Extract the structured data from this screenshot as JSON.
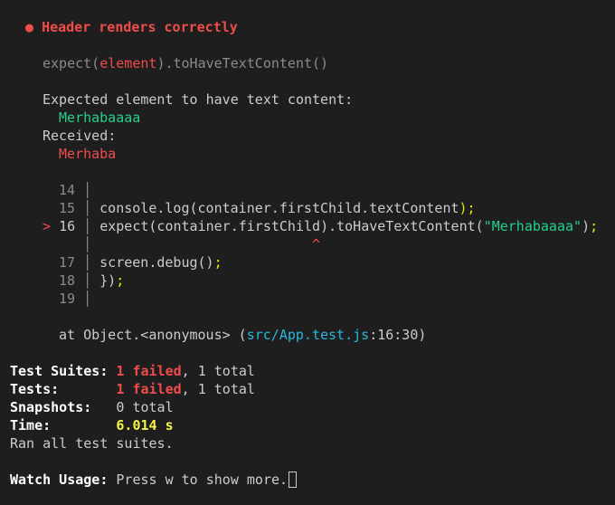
{
  "test": {
    "bullet": "●",
    "name": "Header renders correctly"
  },
  "matcher": {
    "prefix": "expect(",
    "received": "element",
    "suffix": ").toHaveTextContent()"
  },
  "message": {
    "expected_label": "Expected element to have text content:",
    "expected_value": "Merhabaaaa",
    "received_label": "Received:",
    "received_value": "Merhaba"
  },
  "code": {
    "lines": [
      {
        "num": "14",
        "text": ""
      },
      {
        "num": "15",
        "text": "console.log(container.firstChild.textContent);"
      },
      {
        "num": "16",
        "text": "expect(container.firstChild).toHaveTextContent(\"Merhabaaaa\");"
      },
      {
        "num": "17",
        "text": "screen.debug();"
      },
      {
        "num": "18",
        "text": "});"
      },
      {
        "num": "19",
        "text": ""
      }
    ],
    "marker": ">",
    "caret": "^",
    "seg": {
      "l15_a": "console",
      "l15_b": ".log(container.",
      "l15_c": "firstChild",
      "l15_d": ".",
      "l15_e": "textContent",
      "l15_f": ");",
      "l16_a": "expect(container.",
      "l16_b": "firstChild",
      "l16_c": ")",
      "l16_d": ".",
      "l16_e": "toHaveTextContent(",
      "l16_f": "\"Merhabaaaa\"",
      "l16_g": ")",
      "l16_h": ";",
      "l17_a": "screen.debug()",
      "l17_b": ";",
      "l18_a": "})",
      "l18_b": ";"
    }
  },
  "stack": {
    "prefix": "at Object.<anonymous> (",
    "file": "src/App.test.js",
    "location": ":16:30)"
  },
  "summary": {
    "suites_label": "Test Suites:",
    "suites_failed": "1 failed",
    "suites_total": ", 1 total",
    "tests_label": "Tests:",
    "tests_failed": "1 failed",
    "tests_total": ", 1 total",
    "snapshots_label": "Snapshots:",
    "snapshots_value": "0 total",
    "time_label": "Time:",
    "time_value": "6.014 s",
    "ran": "Ran all test suites."
  },
  "watch": {
    "label": "Watch Usage:",
    "text": " Press w to show more."
  }
}
